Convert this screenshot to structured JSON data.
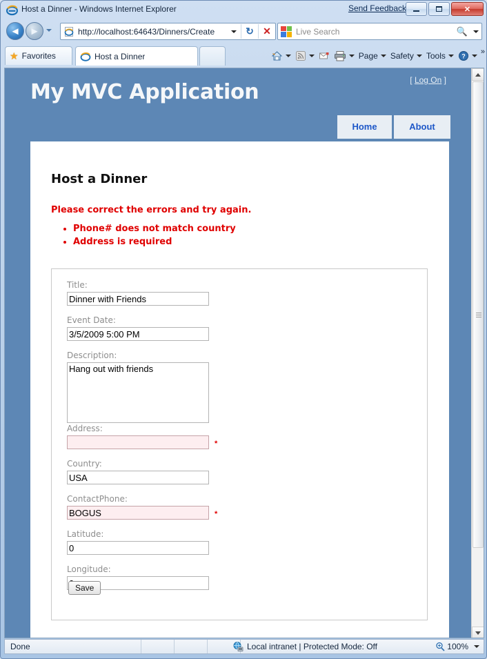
{
  "browser": {
    "title": "Host a Dinner - Windows Internet Explorer",
    "send_feedback": "Send Feedback",
    "window_buttons": {
      "minimize": "minimize-button",
      "maximize": "maximize-button",
      "close": "close-button"
    },
    "address": {
      "url": "http://localhost:64643/Dinners/Create",
      "dropdown_icon": "chevron-down-icon",
      "refresh_icon": "refresh-icon",
      "stop_icon": "stop-icon"
    },
    "search": {
      "placeholder": "Live Search",
      "go_icon": "search-icon",
      "dropdown_icon": "chevron-down-icon"
    },
    "favorites_label": "Favorites",
    "tab_label": "Host a Dinner",
    "new_tab_label": "",
    "toolbar": [
      {
        "label": "",
        "icon": "home-icon",
        "caret": true
      },
      {
        "label": "",
        "icon": "rss-feed-icon",
        "caret": true
      },
      {
        "label": "",
        "icon": "mail-icon",
        "caret": false
      },
      {
        "label": "",
        "icon": "print-icon",
        "caret": true
      },
      {
        "label": "Page",
        "icon": "",
        "caret": true
      },
      {
        "label": "Safety",
        "icon": "",
        "caret": true
      },
      {
        "label": "Tools",
        "icon": "",
        "caret": true
      },
      {
        "label": "",
        "icon": "help-icon",
        "caret": true
      }
    ],
    "toolbar_overflow": "»",
    "statusbar": {
      "status": "Done",
      "zone_icon": "globe-icon",
      "zone": "Local intranet | Protected Mode: Off",
      "zoom_icon": "zoom-icon",
      "zoom": "100%",
      "zoom_caret": "chevron-down-icon"
    }
  },
  "page": {
    "site_title": "My MVC Application",
    "logon": {
      "open_bracket": "[",
      "label": "Log On",
      "close_bracket": "]"
    },
    "nav": [
      {
        "label": "Home"
      },
      {
        "label": "About"
      }
    ],
    "heading": "Host a Dinner",
    "validation": {
      "summary": "Please correct the errors and try again.",
      "errors": [
        "Phone# does not match country",
        "Address is required"
      ]
    },
    "form": {
      "fields": [
        {
          "label": "Title:",
          "value": "Dinner with Friends",
          "type": "text",
          "error": false,
          "star": ""
        },
        {
          "label": "Event Date:",
          "value": "3/5/2009 5:00 PM",
          "type": "text",
          "error": false,
          "star": ""
        },
        {
          "label": "Description:",
          "value": "Hang out with friends",
          "type": "textarea",
          "error": false,
          "star": ""
        },
        {
          "label": "Address:",
          "value": "",
          "type": "text",
          "error": true,
          "star": "*"
        },
        {
          "label": "Country:",
          "value": "USA",
          "type": "text",
          "error": false,
          "star": ""
        },
        {
          "label": "ContactPhone:",
          "value": "BOGUS",
          "type": "text",
          "error": true,
          "star": "*"
        },
        {
          "label": "Latitude:",
          "value": "0",
          "type": "text",
          "error": false,
          "star": ""
        },
        {
          "label": "Longitude:",
          "value": "0",
          "type": "text",
          "error": false,
          "star": ""
        }
      ],
      "save_label": "Save"
    }
  },
  "colors": {
    "header_blue": "#5d87b5",
    "nav_tab_bg": "#e8eef4",
    "nav_link": "#1d57c8",
    "error_red": "#e00000",
    "error_field_bg": "#fdeef0",
    "label_gray": "#8d8d8d"
  }
}
